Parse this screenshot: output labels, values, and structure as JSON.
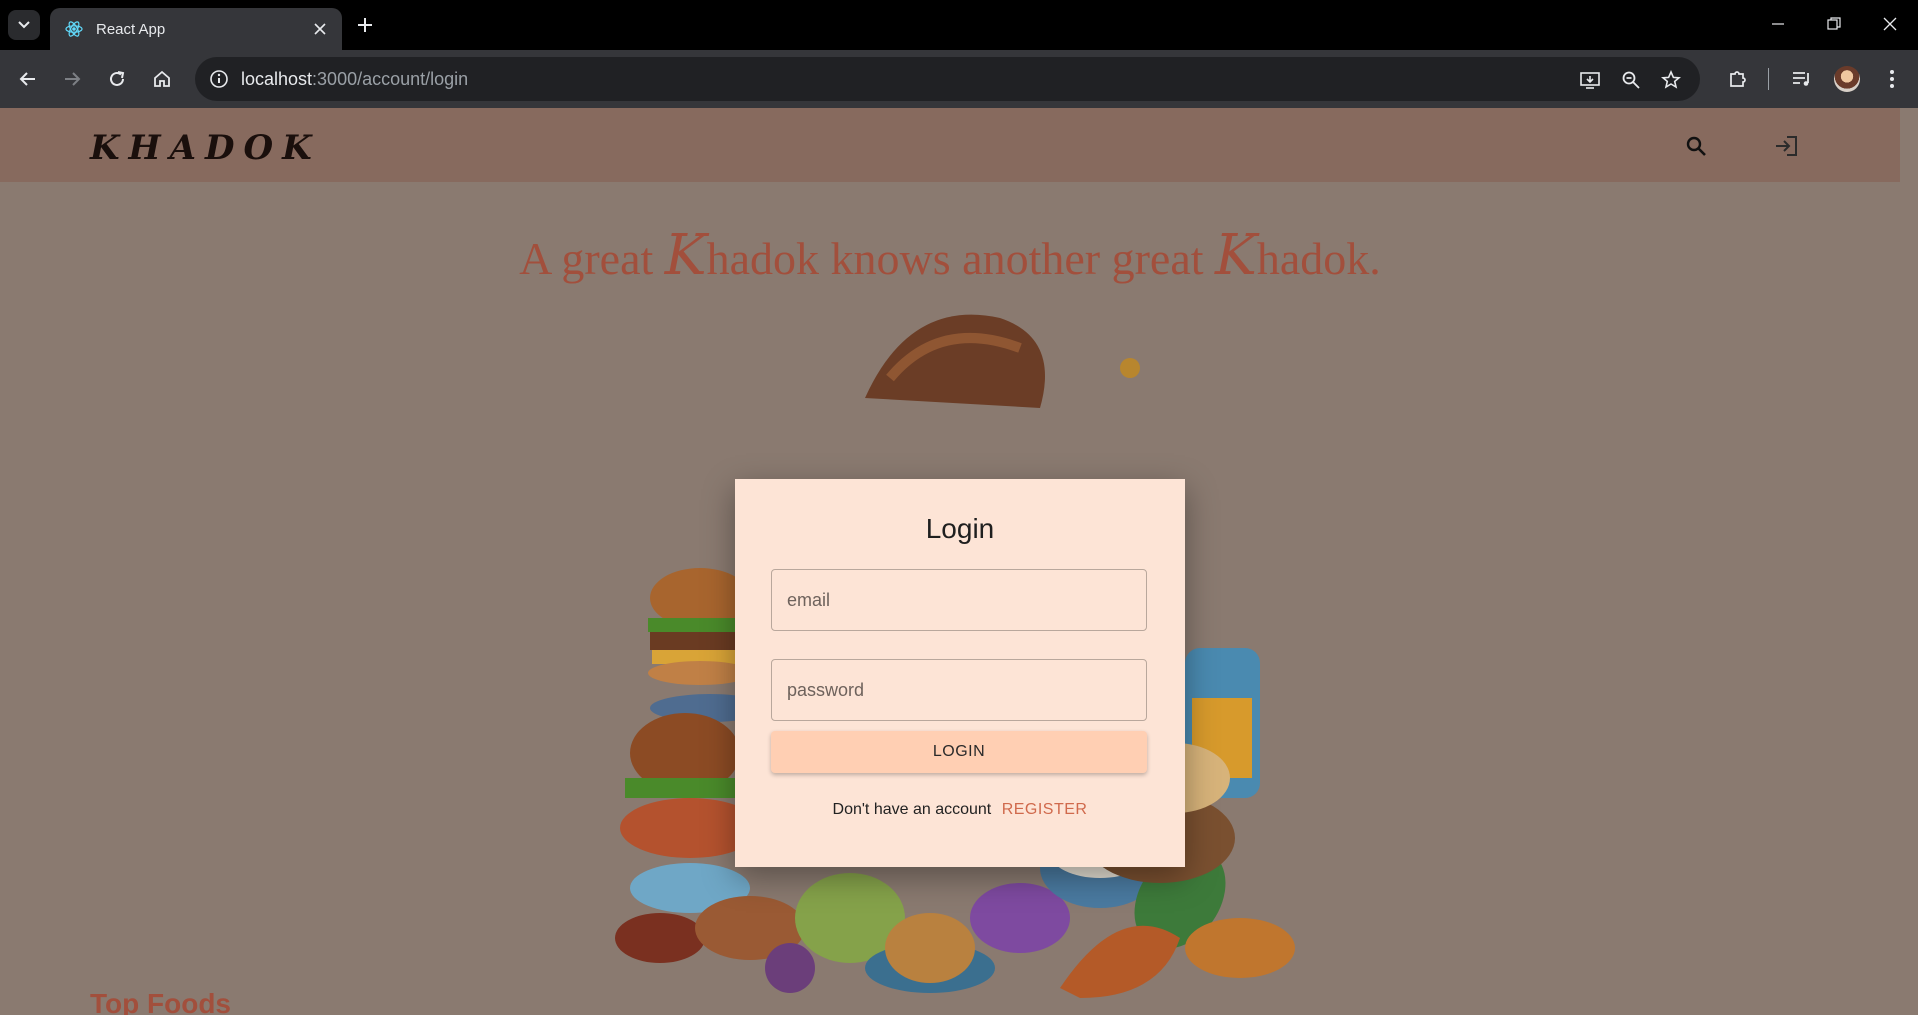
{
  "browser": {
    "tab_title": "React App",
    "url_host": "localhost",
    "url_path": ":3000/account/login"
  },
  "site": {
    "logo": "KHADOK",
    "tagline_part1": "A great ",
    "tagline_k1": "K",
    "tagline_part2": "hadok knows another great ",
    "tagline_k2": "K",
    "tagline_part3": "hadok.",
    "section_title": "Top Foods"
  },
  "login": {
    "title": "Login",
    "email_placeholder": "email",
    "password_placeholder": "password",
    "submit_label": "LOGIN",
    "register_prompt": "Don't have an account",
    "register_label": "REGISTER"
  },
  "icons": {
    "tab_favicon": "react-icon",
    "header_search": "search-icon",
    "header_login": "login-icon"
  },
  "colors": {
    "accent": "#a24f3c",
    "modal_bg": "#fde4d6",
    "button_bg": "#ffcfb3",
    "register_link": "#d0694c"
  }
}
